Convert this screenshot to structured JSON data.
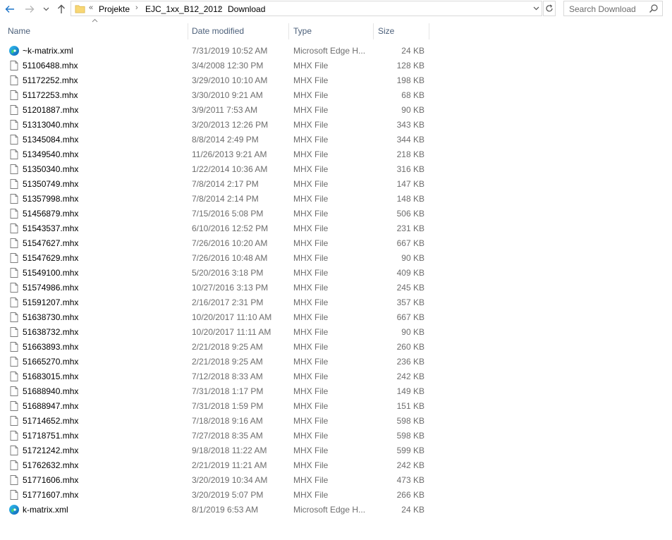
{
  "address": {
    "overflow": "«",
    "crumbs": [
      "Projekte",
      "EJC_1xx_B12_2012",
      "Download"
    ],
    "separator": "›"
  },
  "search": {
    "placeholder": "Search Download"
  },
  "columns": {
    "name": "Name",
    "date": "Date modified",
    "type": "Type",
    "size": "Size"
  },
  "files": [
    {
      "name": "~k-matrix.xml",
      "date": "7/31/2019 10:52 AM",
      "type": "Microsoft Edge H...",
      "size": "24 KB",
      "icon": "edge-icon"
    },
    {
      "name": "51106488.mhx",
      "date": "3/4/2008 12:30 PM",
      "type": "MHX File",
      "size": "128 KB",
      "icon": "file-icon"
    },
    {
      "name": "51172252.mhx",
      "date": "3/29/2010 10:10 AM",
      "type": "MHX File",
      "size": "198 KB",
      "icon": "file-icon"
    },
    {
      "name": "51172253.mhx",
      "date": "3/30/2010 9:21 AM",
      "type": "MHX File",
      "size": "68 KB",
      "icon": "file-icon"
    },
    {
      "name": "51201887.mhx",
      "date": "3/9/2011 7:53 AM",
      "type": "MHX File",
      "size": "90 KB",
      "icon": "file-icon"
    },
    {
      "name": "51313040.mhx",
      "date": "3/20/2013 12:26 PM",
      "type": "MHX File",
      "size": "343 KB",
      "icon": "file-icon"
    },
    {
      "name": "51345084.mhx",
      "date": "8/8/2014 2:49 PM",
      "type": "MHX File",
      "size": "344 KB",
      "icon": "file-icon"
    },
    {
      "name": "51349540.mhx",
      "date": "11/26/2013 9:21 AM",
      "type": "MHX File",
      "size": "218 KB",
      "icon": "file-icon"
    },
    {
      "name": "51350340.mhx",
      "date": "1/22/2014 10:36 AM",
      "type": "MHX File",
      "size": "316 KB",
      "icon": "file-icon"
    },
    {
      "name": "51350749.mhx",
      "date": "7/8/2014 2:17 PM",
      "type": "MHX File",
      "size": "147 KB",
      "icon": "file-icon"
    },
    {
      "name": "51357998.mhx",
      "date": "7/8/2014 2:14 PM",
      "type": "MHX File",
      "size": "148 KB",
      "icon": "file-icon"
    },
    {
      "name": "51456879.mhx",
      "date": "7/15/2016 5:08 PM",
      "type": "MHX File",
      "size": "506 KB",
      "icon": "file-icon"
    },
    {
      "name": "51543537.mhx",
      "date": "6/10/2016 12:52 PM",
      "type": "MHX File",
      "size": "231 KB",
      "icon": "file-icon"
    },
    {
      "name": "51547627.mhx",
      "date": "7/26/2016 10:20 AM",
      "type": "MHX File",
      "size": "667 KB",
      "icon": "file-icon"
    },
    {
      "name": "51547629.mhx",
      "date": "7/26/2016 10:48 AM",
      "type": "MHX File",
      "size": "90 KB",
      "icon": "file-icon"
    },
    {
      "name": "51549100.mhx",
      "date": "5/20/2016 3:18 PM",
      "type": "MHX File",
      "size": "409 KB",
      "icon": "file-icon"
    },
    {
      "name": "51574986.mhx",
      "date": "10/27/2016 3:13 PM",
      "type": "MHX File",
      "size": "245 KB",
      "icon": "file-icon"
    },
    {
      "name": "51591207.mhx",
      "date": "2/16/2017 2:31 PM",
      "type": "MHX File",
      "size": "357 KB",
      "icon": "file-icon"
    },
    {
      "name": "51638730.mhx",
      "date": "10/20/2017 11:10 AM",
      "type": "MHX File",
      "size": "667 KB",
      "icon": "file-icon"
    },
    {
      "name": "51638732.mhx",
      "date": "10/20/2017 11:11 AM",
      "type": "MHX File",
      "size": "90 KB",
      "icon": "file-icon"
    },
    {
      "name": "51663893.mhx",
      "date": "2/21/2018 9:25 AM",
      "type": "MHX File",
      "size": "260 KB",
      "icon": "file-icon"
    },
    {
      "name": "51665270.mhx",
      "date": "2/21/2018 9:25 AM",
      "type": "MHX File",
      "size": "236 KB",
      "icon": "file-icon"
    },
    {
      "name": "51683015.mhx",
      "date": "7/12/2018 8:33 AM",
      "type": "MHX File",
      "size": "242 KB",
      "icon": "file-icon"
    },
    {
      "name": "51688940.mhx",
      "date": "7/31/2018 1:17 PM",
      "type": "MHX File",
      "size": "149 KB",
      "icon": "file-icon"
    },
    {
      "name": "51688947.mhx",
      "date": "7/31/2018 1:59 PM",
      "type": "MHX File",
      "size": "151 KB",
      "icon": "file-icon"
    },
    {
      "name": "51714652.mhx",
      "date": "7/18/2018 9:16 AM",
      "type": "MHX File",
      "size": "598 KB",
      "icon": "file-icon"
    },
    {
      "name": "51718751.mhx",
      "date": "7/27/2018 8:35 AM",
      "type": "MHX File",
      "size": "598 KB",
      "icon": "file-icon"
    },
    {
      "name": "51721242.mhx",
      "date": "9/18/2018 11:22 AM",
      "type": "MHX File",
      "size": "599 KB",
      "icon": "file-icon"
    },
    {
      "name": "51762632.mhx",
      "date": "2/21/2019 11:21 AM",
      "type": "MHX File",
      "size": "242 KB",
      "icon": "file-icon"
    },
    {
      "name": "51771606.mhx",
      "date": "3/20/2019 10:34 AM",
      "type": "MHX File",
      "size": "473 KB",
      "icon": "file-icon"
    },
    {
      "name": "51771607.mhx",
      "date": "3/20/2019 5:07 PM",
      "type": "MHX File",
      "size": "266 KB",
      "icon": "file-icon"
    },
    {
      "name": "k-matrix.xml",
      "date": "8/1/2019 6:53 AM",
      "type": "Microsoft Edge H...",
      "size": "24 KB",
      "icon": "edge-icon"
    }
  ],
  "colors": {
    "accent": "#1a73c8",
    "header_text": "#4c607a",
    "meta_text": "#6d6d6d",
    "folder": "#f8d775"
  }
}
